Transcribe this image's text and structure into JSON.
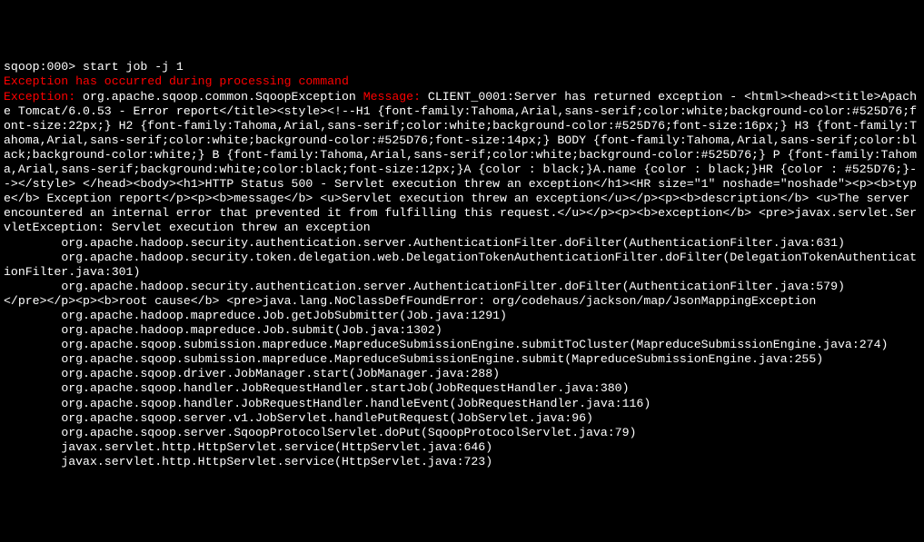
{
  "prompt": {
    "label": "sqoop:000>",
    "command": " start job -j 1"
  },
  "error": {
    "title": "Exception has occurred during processing command",
    "exception_label": "Exception:",
    "exception_class": " org.apache.sqoop.common.SqoopException ",
    "message_label": "Message:",
    "message_body": " CLIENT_0001:Server has returned exception - <html><head><title>Apache Tomcat/6.0.53 - Error report</title><style><!--H1 {font-family:Tahoma,Arial,sans-serif;color:white;background-color:#525D76;font-size:22px;} H2 {font-family:Tahoma,Arial,sans-serif;color:white;background-color:#525D76;font-size:16px;} H3 {font-family:Tahoma,Arial,sans-serif;color:white;background-color:#525D76;font-size:14px;} BODY {font-family:Tahoma,Arial,sans-serif;color:black;background-color:white;} B {font-family:Tahoma,Arial,sans-serif;color:white;background-color:#525D76;} P {font-family:Tahoma,Arial,sans-serif;background:white;color:black;font-size:12px;}A {color : black;}A.name {color : black;}HR {color : #525D76;}--></style> </head><body><h1>HTTP Status 500 - Servlet execution threw an exception</h1><HR size=\"1\" noshade=\"noshade\"><p><b>type</b> Exception report</p><p><b>message</b> <u>Servlet execution threw an exception</u></p><p><b>description</b> <u>The server encountered an internal error that prevented it from fulfilling this request.</u></p><p><b>exception</b> <pre>javax.servlet.ServletException: Servlet execution threw an exception"
  },
  "stack1": [
    "        org.apache.hadoop.security.authentication.server.AuthenticationFilter.doFilter(AuthenticationFilter.java:631)",
    "        org.apache.hadoop.security.token.delegation.web.DelegationTokenAuthenticationFilter.doFilter(DelegationTokenAuthenticationFilter.java:301)",
    "        org.apache.hadoop.security.authentication.server.AuthenticationFilter.doFilter(AuthenticationFilter.java:579)"
  ],
  "rootcause_line": "</pre></p><p><b>root cause</b> <pre>java.lang.NoClassDefFoundError: org/codehaus/jackson/map/JsonMappingException",
  "stack2": [
    "        org.apache.hadoop.mapreduce.Job.getJobSubmitter(Job.java:1291)",
    "        org.apache.hadoop.mapreduce.Job.submit(Job.java:1302)",
    "        org.apache.sqoop.submission.mapreduce.MapreduceSubmissionEngine.submitToCluster(MapreduceSubmissionEngine.java:274)",
    "        org.apache.sqoop.submission.mapreduce.MapreduceSubmissionEngine.submit(MapreduceSubmissionEngine.java:255)",
    "        org.apache.sqoop.driver.JobManager.start(JobManager.java:288)",
    "        org.apache.sqoop.handler.JobRequestHandler.startJob(JobRequestHandler.java:380)",
    "        org.apache.sqoop.handler.JobRequestHandler.handleEvent(JobRequestHandler.java:116)",
    "        org.apache.sqoop.server.v1.JobServlet.handlePutRequest(JobServlet.java:96)",
    "        org.apache.sqoop.server.SqoopProtocolServlet.doPut(SqoopProtocolServlet.java:79)",
    "        javax.servlet.http.HttpServlet.service(HttpServlet.java:646)",
    "        javax.servlet.http.HttpServlet.service(HttpServlet.java:723)"
  ]
}
